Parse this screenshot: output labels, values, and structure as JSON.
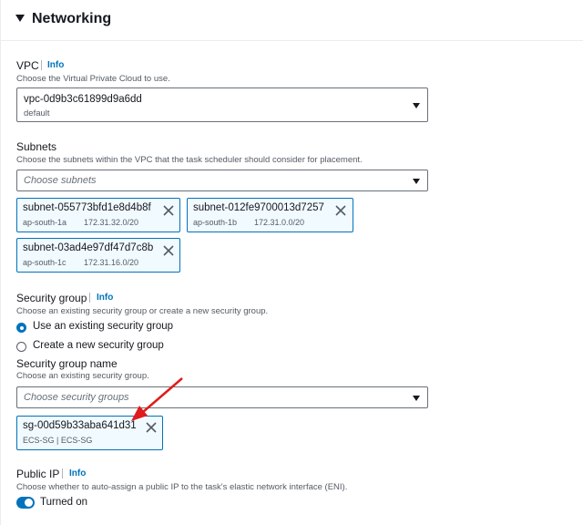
{
  "section": {
    "title": "Networking"
  },
  "vpc": {
    "label": "VPC",
    "info": "Info",
    "description": "Choose the Virtual Private Cloud to use.",
    "selected_value": "vpc-0d9b3c61899d9a6dd",
    "selected_sub": "default"
  },
  "subnets": {
    "label": "Subnets",
    "description": "Choose the subnets within the VPC that the task scheduler should consider for placement.",
    "placeholder": "Choose subnets",
    "tokens": [
      {
        "name": "subnet-055773bfd1e8d4b8f",
        "zone": "ap-south-1a",
        "cidr": "172.31.32.0/20"
      },
      {
        "name": "subnet-012fe9700013d7257",
        "zone": "ap-south-1b",
        "cidr": "172.31.0.0/20"
      },
      {
        "name": "subnet-03ad4e97df47d7c8b",
        "zone": "ap-south-1c",
        "cidr": "172.31.16.0/20"
      }
    ]
  },
  "security_group": {
    "label": "Security group",
    "info": "Info",
    "description": "Choose an existing security group or create a new security group.",
    "options": [
      {
        "label": "Use an existing security group",
        "selected": true
      },
      {
        "label": "Create a new security group",
        "selected": false
      }
    ],
    "name_label": "Security group name",
    "name_description": "Choose an existing security group.",
    "placeholder": "Choose security groups",
    "token": {
      "name": "sg-00d59b33aba641d31",
      "sub": "ECS-SG | ECS-SG"
    }
  },
  "public_ip": {
    "label": "Public IP",
    "info": "Info",
    "description": "Choose whether to auto-assign a public IP to the task's elastic network interface (ENI).",
    "toggle_label": "Turned on",
    "enabled": true
  },
  "colors": {
    "accent": "#0073bb",
    "token_bg": "#f1faff",
    "annotation_arrow": "#e01b1b"
  }
}
